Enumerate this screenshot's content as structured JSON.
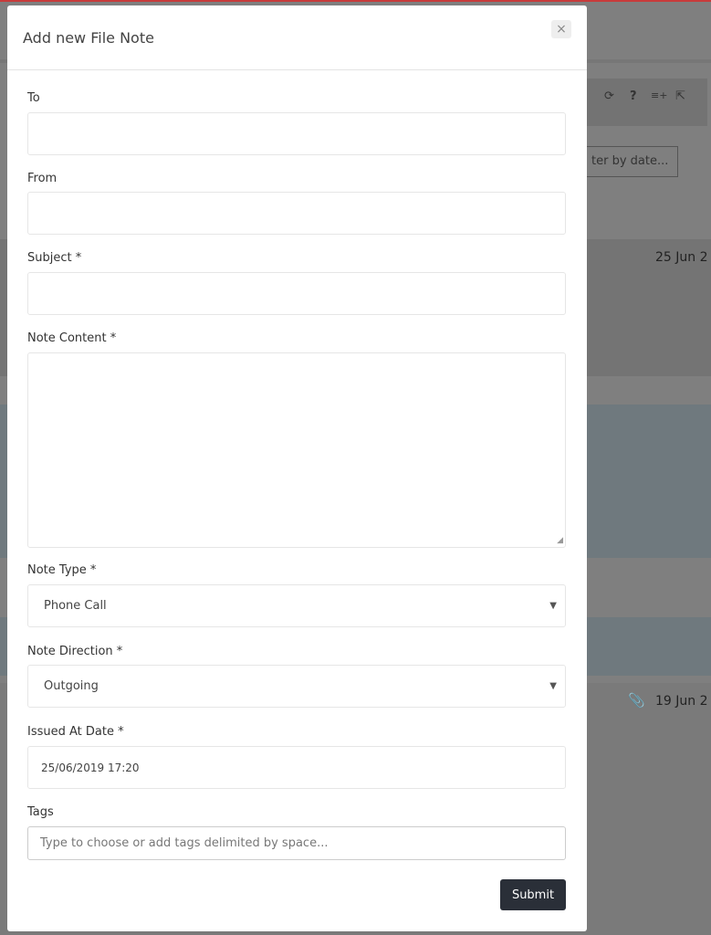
{
  "background": {
    "filter_placeholder": "ter by date...",
    "row1_date": "25 Jun 2",
    "row2_date": "19 Jun 2",
    "toolbar_icons": [
      "refresh-icon",
      "help-icon",
      "add-list-icon",
      "export-icon"
    ]
  },
  "modal": {
    "title": "Add new File Note",
    "close": "×",
    "fields": {
      "to": {
        "label": "To",
        "value": ""
      },
      "from": {
        "label": "From",
        "value": ""
      },
      "subject": {
        "label": "Subject *",
        "value": ""
      },
      "content": {
        "label": "Note Content *",
        "value": ""
      },
      "type": {
        "label": "Note Type *",
        "value": "Phone Call"
      },
      "direction": {
        "label": "Note Direction *",
        "value": "Outgoing"
      },
      "issued": {
        "label": "Issued At Date *",
        "value": "25/06/2019 17:20"
      },
      "tags": {
        "label": "Tags",
        "placeholder": "Type to choose or add tags delimited by space..."
      }
    },
    "submit": "Submit"
  }
}
